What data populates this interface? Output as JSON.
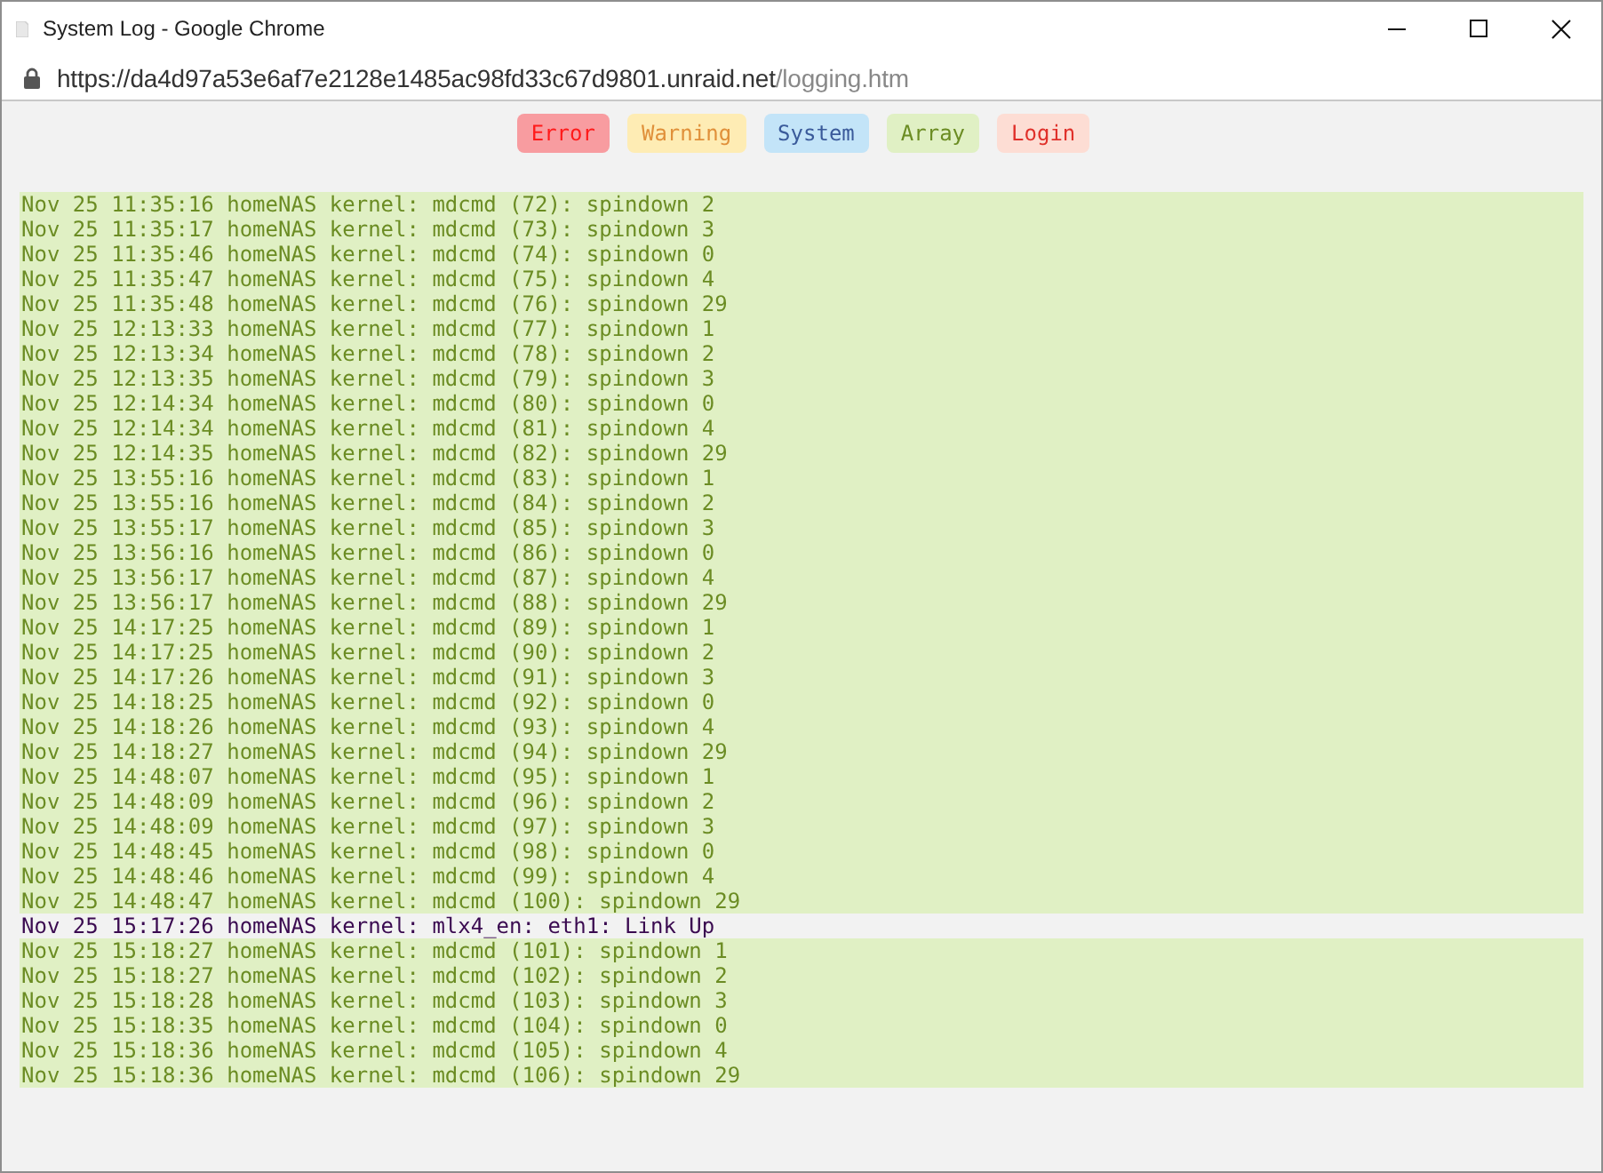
{
  "window": {
    "title": "System Log - Google Chrome"
  },
  "address_bar": {
    "host": "https://da4d97a53e6af7e2128e1485ac98fd33c67d9801.unraid.net",
    "path": "/logging.htm"
  },
  "filters": [
    {
      "label": "Error",
      "kind": "error"
    },
    {
      "label": "Warning",
      "kind": "warning"
    },
    {
      "label": "System",
      "kind": "system"
    },
    {
      "label": "Array",
      "kind": "array"
    },
    {
      "label": "Login",
      "kind": "login"
    }
  ],
  "log_lines": [
    {
      "text": "Nov 25 11:35:16 homeNAS kernel: mdcmd (72): spindown 2",
      "kind": "array"
    },
    {
      "text": "Nov 25 11:35:17 homeNAS kernel: mdcmd (73): spindown 3",
      "kind": "array"
    },
    {
      "text": "Nov 25 11:35:46 homeNAS kernel: mdcmd (74): spindown 0",
      "kind": "array"
    },
    {
      "text": "Nov 25 11:35:47 homeNAS kernel: mdcmd (75): spindown 4",
      "kind": "array"
    },
    {
      "text": "Nov 25 11:35:48 homeNAS kernel: mdcmd (76): spindown 29",
      "kind": "array"
    },
    {
      "text": "Nov 25 12:13:33 homeNAS kernel: mdcmd (77): spindown 1",
      "kind": "array"
    },
    {
      "text": "Nov 25 12:13:34 homeNAS kernel: mdcmd (78): spindown 2",
      "kind": "array"
    },
    {
      "text": "Nov 25 12:13:35 homeNAS kernel: mdcmd (79): spindown 3",
      "kind": "array"
    },
    {
      "text": "Nov 25 12:14:34 homeNAS kernel: mdcmd (80): spindown 0",
      "kind": "array"
    },
    {
      "text": "Nov 25 12:14:34 homeNAS kernel: mdcmd (81): spindown 4",
      "kind": "array"
    },
    {
      "text": "Nov 25 12:14:35 homeNAS kernel: mdcmd (82): spindown 29",
      "kind": "array"
    },
    {
      "text": "Nov 25 13:55:16 homeNAS kernel: mdcmd (83): spindown 1",
      "kind": "array"
    },
    {
      "text": "Nov 25 13:55:16 homeNAS kernel: mdcmd (84): spindown 2",
      "kind": "array"
    },
    {
      "text": "Nov 25 13:55:17 homeNAS kernel: mdcmd (85): spindown 3",
      "kind": "array"
    },
    {
      "text": "Nov 25 13:56:16 homeNAS kernel: mdcmd (86): spindown 0",
      "kind": "array"
    },
    {
      "text": "Nov 25 13:56:17 homeNAS kernel: mdcmd (87): spindown 4",
      "kind": "array"
    },
    {
      "text": "Nov 25 13:56:17 homeNAS kernel: mdcmd (88): spindown 29",
      "kind": "array"
    },
    {
      "text": "Nov 25 14:17:25 homeNAS kernel: mdcmd (89): spindown 1",
      "kind": "array"
    },
    {
      "text": "Nov 25 14:17:25 homeNAS kernel: mdcmd (90): spindown 2",
      "kind": "array"
    },
    {
      "text": "Nov 25 14:17:26 homeNAS kernel: mdcmd (91): spindown 3",
      "kind": "array"
    },
    {
      "text": "Nov 25 14:18:25 homeNAS kernel: mdcmd (92): spindown 0",
      "kind": "array"
    },
    {
      "text": "Nov 25 14:18:26 homeNAS kernel: mdcmd (93): spindown 4",
      "kind": "array"
    },
    {
      "text": "Nov 25 14:18:27 homeNAS kernel: mdcmd (94): spindown 29",
      "kind": "array"
    },
    {
      "text": "Nov 25 14:48:07 homeNAS kernel: mdcmd (95): spindown 1",
      "kind": "array"
    },
    {
      "text": "Nov 25 14:48:09 homeNAS kernel: mdcmd (96): spindown 2",
      "kind": "array"
    },
    {
      "text": "Nov 25 14:48:09 homeNAS kernel: mdcmd (97): spindown 3",
      "kind": "array"
    },
    {
      "text": "Nov 25 14:48:45 homeNAS kernel: mdcmd (98): spindown 0",
      "kind": "array"
    },
    {
      "text": "Nov 25 14:48:46 homeNAS kernel: mdcmd (99): spindown 4",
      "kind": "array"
    },
    {
      "text": "Nov 25 14:48:47 homeNAS kernel: mdcmd (100): spindown 29",
      "kind": "array"
    },
    {
      "text": "Nov 25 15:17:26 homeNAS kernel: mlx4_en: eth1: Link Up",
      "kind": "plain"
    },
    {
      "text": "Nov 25 15:18:27 homeNAS kernel: mdcmd (101): spindown 1",
      "kind": "array"
    },
    {
      "text": "Nov 25 15:18:27 homeNAS kernel: mdcmd (102): spindown 2",
      "kind": "array"
    },
    {
      "text": "Nov 25 15:18:28 homeNAS kernel: mdcmd (103): spindown 3",
      "kind": "array"
    },
    {
      "text": "Nov 25 15:18:35 homeNAS kernel: mdcmd (104): spindown 0",
      "kind": "array"
    },
    {
      "text": "Nov 25 15:18:36 homeNAS kernel: mdcmd (105): spindown 4",
      "kind": "array"
    },
    {
      "text": "Nov 25 15:18:36 homeNAS kernel: mdcmd (106): spindown 29",
      "kind": "array"
    }
  ]
}
